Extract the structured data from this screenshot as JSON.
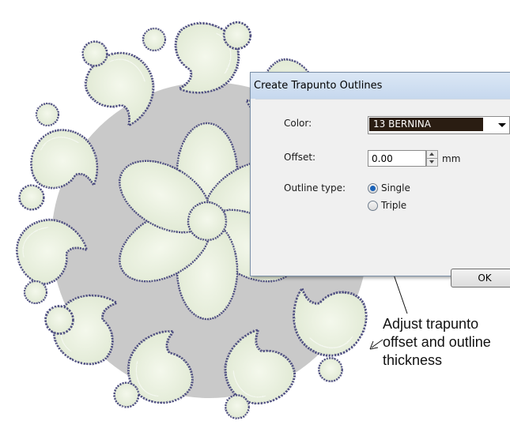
{
  "dialog": {
    "title": "Create Trapunto Outlines",
    "color_label": "Color:",
    "color_value": "13 BERNINA",
    "color_swatch": "#2a1d12",
    "offset_label": "Offset:",
    "offset_value": "0.00",
    "offset_unit": "mm",
    "outline_type_label": "Outline type:",
    "outline_options": [
      {
        "label": "Single",
        "selected": true
      },
      {
        "label": "Triple",
        "selected": false
      }
    ],
    "ok_label": "OK"
  },
  "annotation": {
    "lines": [
      "Adjust trapunto",
      "offset and outline",
      "thickness"
    ]
  },
  "artwork": {
    "fill_color": "#e8f0dc",
    "outline_color": "#4e4e80",
    "shadow_color": "#9c9c9c"
  }
}
